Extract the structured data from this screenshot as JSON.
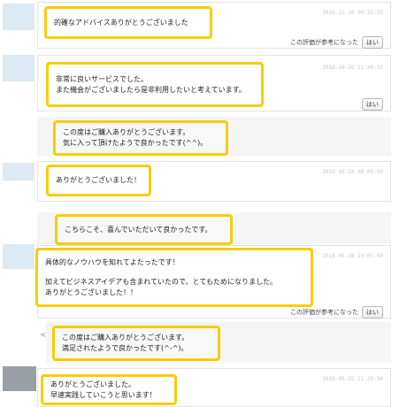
{
  "reviews": [
    {
      "timestamp": "2018-11-10 00:32:35",
      "lines": [
        "的確なアドバイスありがとうございました"
      ],
      "helpful_prompt": "この評価が参考になった",
      "helpful_button": "はい"
    },
    {
      "timestamp": "2018-10-26 21:44:33",
      "lines": [
        "非常に良いサービスでした。",
        "また機会がございましたら是非利用したいと考えています。"
      ],
      "helpful_button": "はい"
    },
    {
      "reply_lines": [
        "この度はご購入ありがとうございます。",
        "気に入って頂けたようで良かったです(^^)。"
      ]
    },
    {
      "timestamp": "2018-06-24 00:05:59",
      "lines": [
        "ありがとうございました！"
      ]
    },
    {
      "reply_lines": [
        "こちらこそ、喜んでいただいて良かったです。"
      ]
    },
    {
      "timestamp": "2018-05-28 19:05:49",
      "lines": [
        "具体的なノウハウを知れてよたったです！",
        "",
        "加えてビジネスアイデアも含まれていたので、とてもためになりました。",
        "ありがとうございました！！"
      ],
      "helpful_prompt": "この評価が参考になった",
      "helpful_button": "はい"
    },
    {
      "reply_lines": [
        "この度はご購入ありがとうございます。",
        "満足されたようで良かったです(^-^)。"
      ]
    },
    {
      "timestamp": "2018-05-25 21:29:30",
      "lines": [
        "ありがとうございました。",
        "早速実践していこうと思います！"
      ]
    }
  ],
  "expand_glyph": "<"
}
